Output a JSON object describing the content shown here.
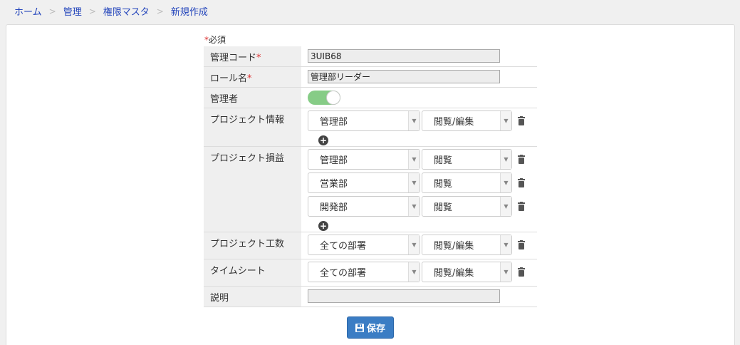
{
  "breadcrumb": {
    "items": [
      "ホーム",
      "管理",
      "権限マスタ",
      "新規作成"
    ],
    "separator": ">"
  },
  "form": {
    "required_note": "必須",
    "required_mark": "*",
    "code": {
      "label": "管理コード",
      "value": "3UIB68"
    },
    "role": {
      "label": "ロール名",
      "value": "管理部リーダー"
    },
    "admin": {
      "label": "管理者",
      "enabled": true
    },
    "project_info": {
      "label": "プロジェクト情報",
      "rows": [
        {
          "dept": "管理部",
          "level": "閲覧/編集"
        }
      ]
    },
    "project_pl": {
      "label": "プロジェクト損益",
      "rows": [
        {
          "dept": "管理部",
          "level": "閲覧"
        },
        {
          "dept": "営業部",
          "level": "閲覧"
        },
        {
          "dept": "開発部",
          "level": "閲覧"
        }
      ]
    },
    "project_hours": {
      "label": "プロジェクト工数",
      "rows": [
        {
          "dept": "全ての部署",
          "level": "閲覧/編集"
        }
      ]
    },
    "timesheet": {
      "label": "タイムシート",
      "rows": [
        {
          "dept": "全ての部署",
          "level": "閲覧/編集"
        }
      ]
    },
    "description": {
      "label": "説明",
      "value": ""
    },
    "save_label": "保存"
  },
  "colors": {
    "link": "#2244bb",
    "toggle_on": "#86cc86",
    "primary": "#3b7dc4",
    "required": "#d33"
  },
  "icons": [
    "chevron-down-icon",
    "trash-icon",
    "plus-circle-icon",
    "floppy-disk-icon"
  ]
}
